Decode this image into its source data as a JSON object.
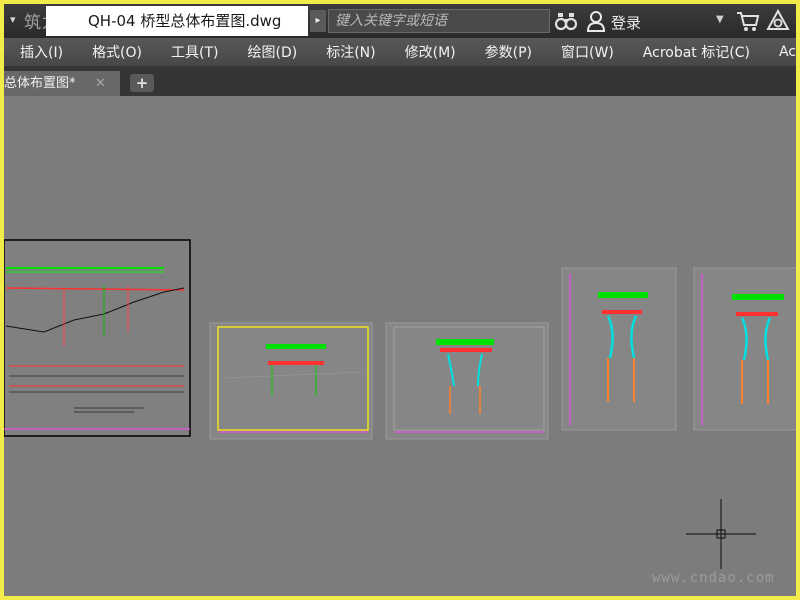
{
  "titlebar": {
    "watermark": "筑龙网",
    "document_title": "QH-04 桥型总体布置图.dwg",
    "search_placeholder": "键入关键字或短语",
    "login_label": "登录",
    "dropdown_arrow": "▼",
    "quick_access_arrow": "▾"
  },
  "menu": {
    "items": [
      {
        "label": "插入(I)"
      },
      {
        "label": "格式(O)"
      },
      {
        "label": "工具(T)"
      },
      {
        "label": "绘图(D)"
      },
      {
        "label": "标注(N)"
      },
      {
        "label": "修改(M)"
      },
      {
        "label": "参数(P)"
      },
      {
        "label": "窗口(W)"
      },
      {
        "label": "Acrobat 标记(C)"
      },
      {
        "label": "Ac"
      }
    ]
  },
  "tabs": {
    "active_label": "总体布置图*",
    "close_symbol": "✕",
    "new_tab_symbol": "+"
  },
  "canvas": {
    "watermark": "www.cndao.com",
    "background_color": "#7c7c7c"
  }
}
